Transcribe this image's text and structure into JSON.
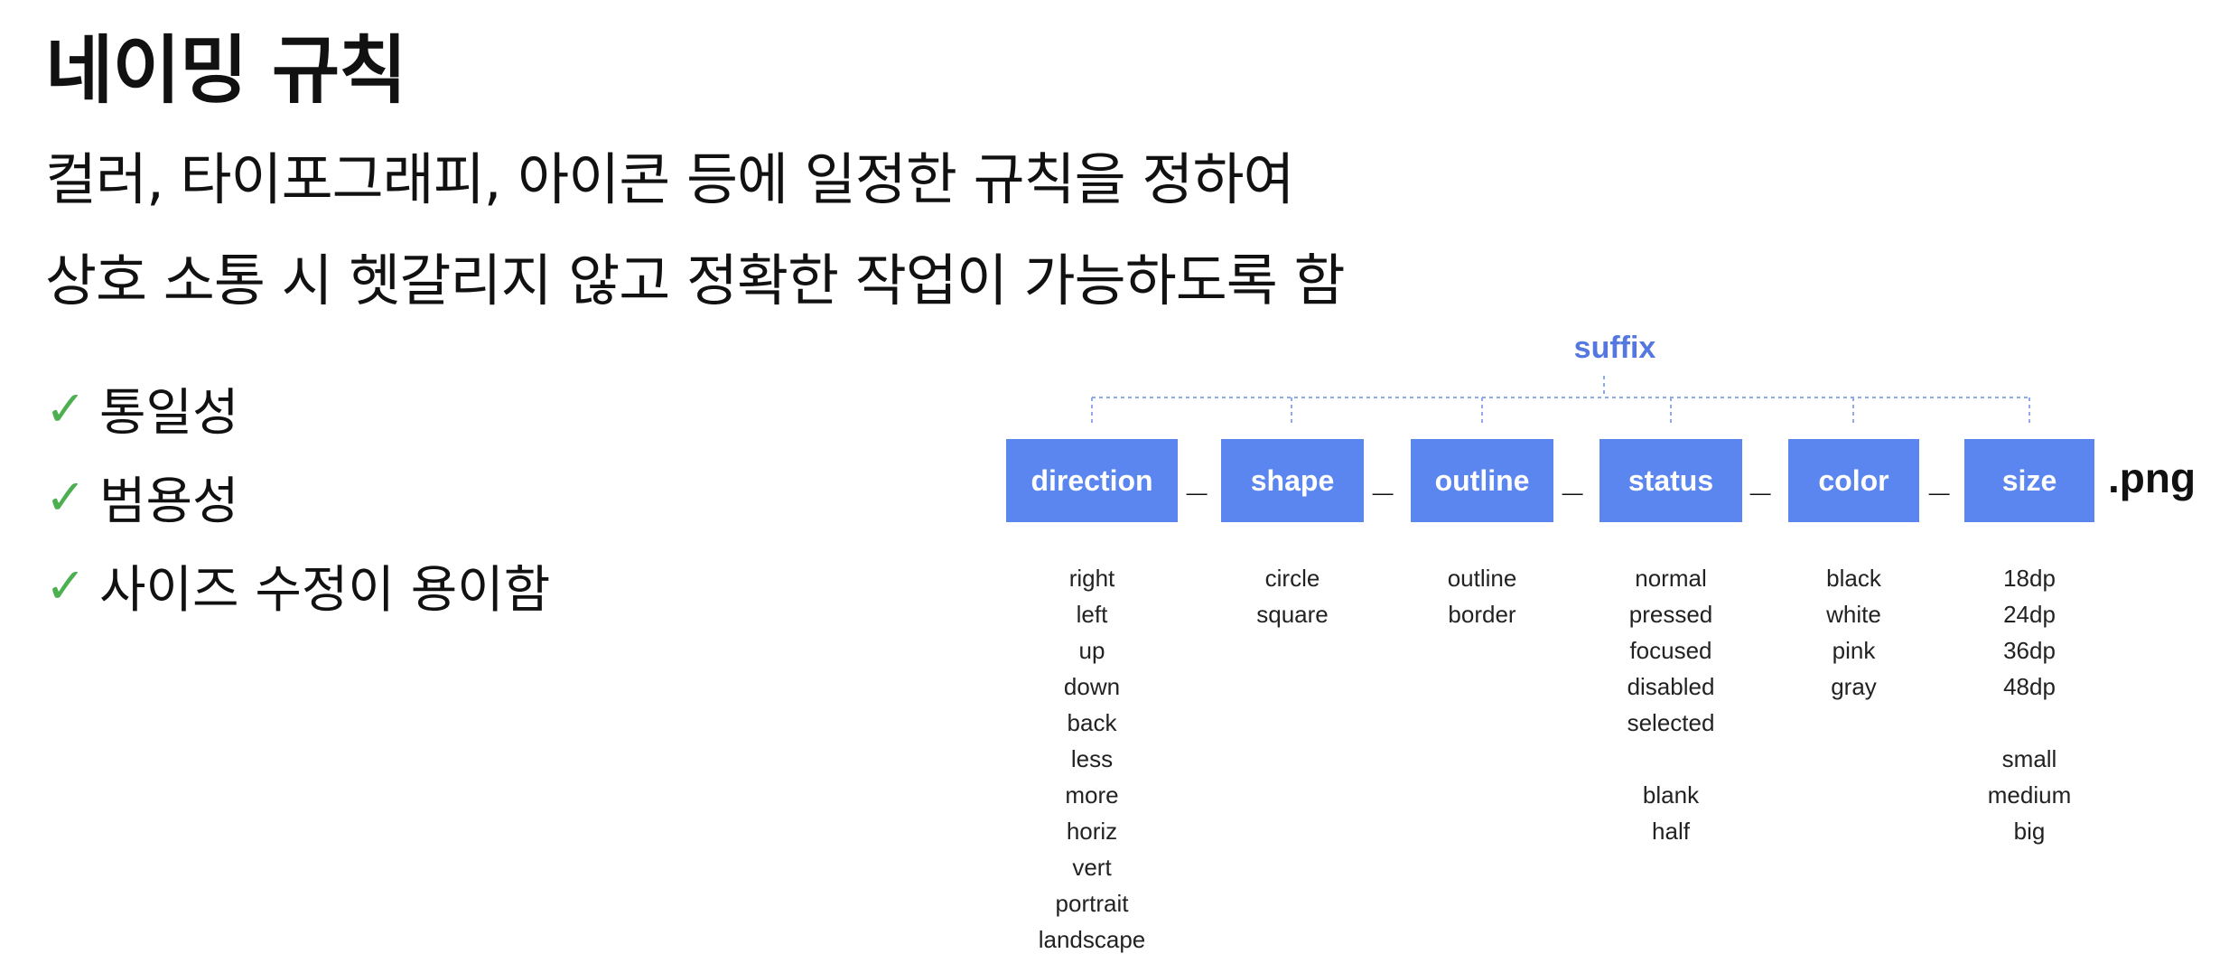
{
  "title": "네이밍 규칙",
  "description": [
    "컬러, 타이포그래피, 아이콘 등에 일정한 규칙을 정하여",
    "상호 소통 시 헷갈리지 않고 정확한 작업이 가능하도록 함"
  ],
  "bullets": [
    {
      "mark": "✓",
      "text": "통일성"
    },
    {
      "mark": "✓",
      "text": "범용성"
    },
    {
      "mark": "✓",
      "text": "사이즈 수정이 용이함"
    }
  ],
  "diagram": {
    "suffix_label": "suffix",
    "separator": "_",
    "extension": ".png",
    "segment_color": "#5b86f0",
    "suffix_color": "#5478e0",
    "segments": [
      {
        "label": "direction",
        "values": [
          "right",
          "left",
          "up",
          "down",
          "back",
          "less",
          "more",
          "horiz",
          "vert",
          "portrait",
          "landscape"
        ]
      },
      {
        "label": "shape",
        "values": [
          "circle",
          "square"
        ]
      },
      {
        "label": "outline",
        "values": [
          "outline",
          "border"
        ]
      },
      {
        "label": "status",
        "values": [
          "normal",
          "pressed",
          "focused",
          "disabled",
          "selected",
          "",
          "blank",
          "half"
        ]
      },
      {
        "label": "color",
        "values": [
          "black",
          "white",
          "pink",
          "gray"
        ]
      },
      {
        "label": "size",
        "values": [
          "18dp",
          "24dp",
          "36dp",
          "48dp",
          "",
          "small",
          "medium",
          "big"
        ]
      }
    ]
  }
}
